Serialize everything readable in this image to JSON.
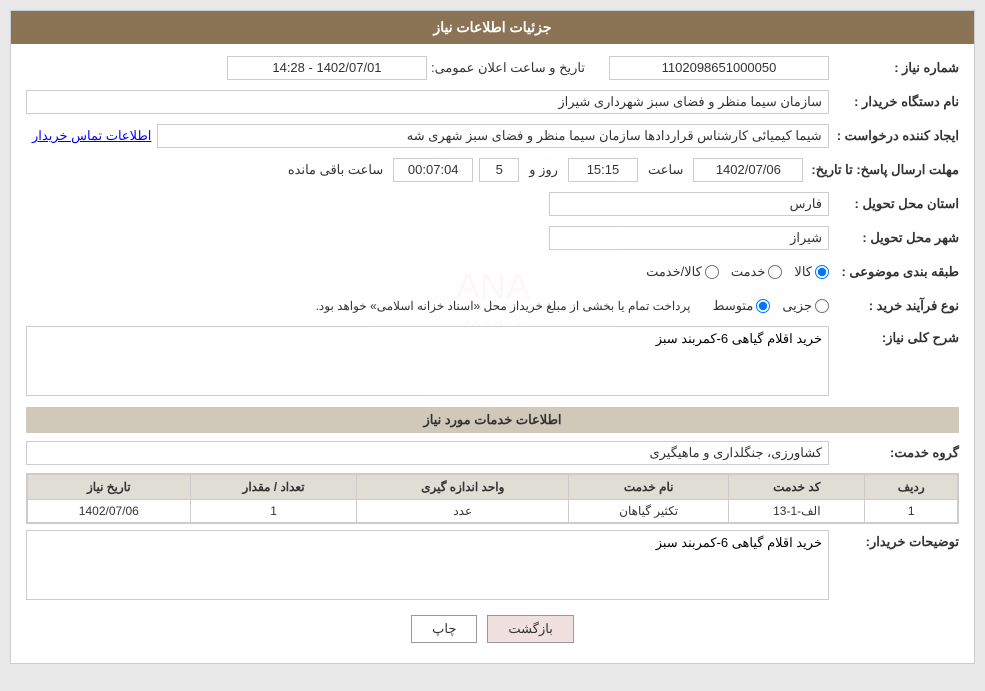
{
  "header": {
    "title": "جزئیات اطلاعات نیاز"
  },
  "fields": {
    "shomara_niaz_label": "شماره نیاز :",
    "shomara_niaz_value": "1102098651000050",
    "nam_dastgah_label": "نام دستگاه خریدار :",
    "nam_dastgah_value": "سازمان سیما منظر و فضای سبز شهرداری شیراز",
    "ejad_konande_label": "ایجاد کننده درخواست :",
    "ejad_konande_value": "شیما کیمیائی کارشناس قراردادها سازمان سیما منظر و فضای سبز شهری شه",
    "etelaat_tamas_label": "اطلاعات تماس خریدار",
    "mohlat_label": "مهلت ارسال پاسخ: تا تاریخ:",
    "tarikh_value": "1402/07/06",
    "saat_label": "ساعت",
    "saat_value": "15:15",
    "roz_label": "روز و",
    "roz_value": "5",
    "saat_baqi_value": "00:07:04",
    "saat_baqi_label": "ساعت باقی مانده",
    "ostan_label": "استان محل تحویل :",
    "ostan_value": "فارس",
    "shahr_label": "شهر محل تحویل :",
    "shahr_value": "شیراز",
    "tabaqa_label": "طبقه بندی موضوعی :",
    "tabaqa_options": [
      {
        "label": "کالا",
        "value": "kala",
        "checked": true
      },
      {
        "label": "خدمت",
        "value": "khedmat",
        "checked": false
      },
      {
        "label": "کالا/خدمت",
        "value": "kala_khedmat",
        "checked": false
      }
    ],
    "nooe_farayand_label": "نوع فرآیند خرید :",
    "nooe_farayand_options": [
      {
        "label": "جزیی",
        "value": "jozi",
        "checked": false
      },
      {
        "label": "متوسط",
        "value": "motavaset",
        "checked": true
      }
    ],
    "nooe_farayand_note": "پرداخت تمام یا بخشی از مبلغ خریداز محل «اسناد خزانه اسلامی» خواهد بود.",
    "sharh_kolli_label": "شرح کلی نیاز:",
    "sharh_kolli_value": "خرید اقلام گیاهی 6-کمربند سبز",
    "section_khadamat_label": "اطلاعات خدمات مورد نیاز",
    "gorooh_khedmat_label": "گروه خدمت:",
    "gorooh_khedmat_value": "کشاورزی، جنگلداری و ماهیگیری",
    "table_headers": [
      "ردیف",
      "کد خدمت",
      "نام خدمت",
      "واحد اندازه گیری",
      "تعداد / مقدار",
      "تاریخ نیاز"
    ],
    "table_rows": [
      {
        "radif": "1",
        "kod": "الف-1-13",
        "nam": "تکثیر گیاهان",
        "vahed": "عدد",
        "tedad": "1",
        "tarikh": "1402/07/06"
      }
    ],
    "tosihaat_label": "توضیحات خریدار:",
    "tosihaat_value": "خرید اقلام گیاهی 6-کمربند سبز",
    "btn_chap": "چاپ",
    "btn_bazgasht": "بازگشت",
    "tarikh_elan_label": "تاریخ و ساعت اعلان عمومی:",
    "tarikh_elan_value": "1402/07/01 - 14:28"
  }
}
